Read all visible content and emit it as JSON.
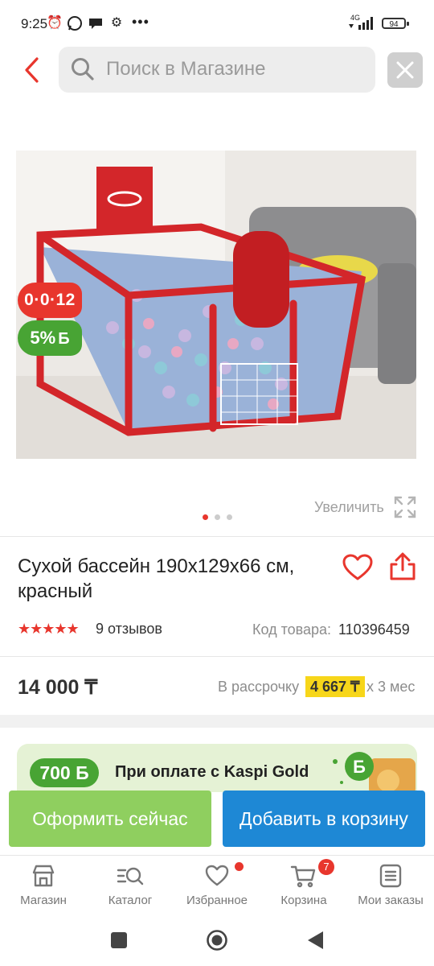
{
  "status_bar": {
    "time": "9:25",
    "icons": [
      "alarm-icon",
      "whatsapp-icon",
      "chat-icon",
      "settings-gear-icon"
    ],
    "more": "•••",
    "network": "4G",
    "battery": "94"
  },
  "header": {
    "search_placeholder": "Поиск в Магазине"
  },
  "gallery": {
    "timer_badge": "0·0·12",
    "bonus_badge": "5%",
    "bonus_symbol": "Б",
    "zoom_label": "Увеличить",
    "slides_count": 3,
    "active_slide": 1
  },
  "product": {
    "title": "Сухой бассейн 190x129x66 см, красный",
    "rating": 5,
    "stars": "★★★★★",
    "reviews": "9 отзывов",
    "code_label": "Код товара:",
    "code_value": "110396459",
    "price": "14 000 ₸",
    "installment_label": "В рассрочку",
    "installment_amount": "4 667 ₸",
    "installment_term": "x 3 мес"
  },
  "promo": {
    "bonus": "700 Б",
    "text": "При оплате с Kaspi Gold"
  },
  "actions": {
    "buy_now": "Оформить сейчас",
    "add_to_cart": "Добавить в корзину"
  },
  "bottom_nav": {
    "shop": "Магазин",
    "catalog": "Каталог",
    "favorites": "Избранное",
    "cart": "Корзина",
    "cart_count": "7",
    "orders": "Мои заказы"
  },
  "colors": {
    "accent_red": "#e8362d",
    "kaspi_green": "#48a434",
    "buy_now_green": "#8fcf5f",
    "cart_blue": "#1e88d5",
    "installment_yellow": "#f7d61a"
  }
}
